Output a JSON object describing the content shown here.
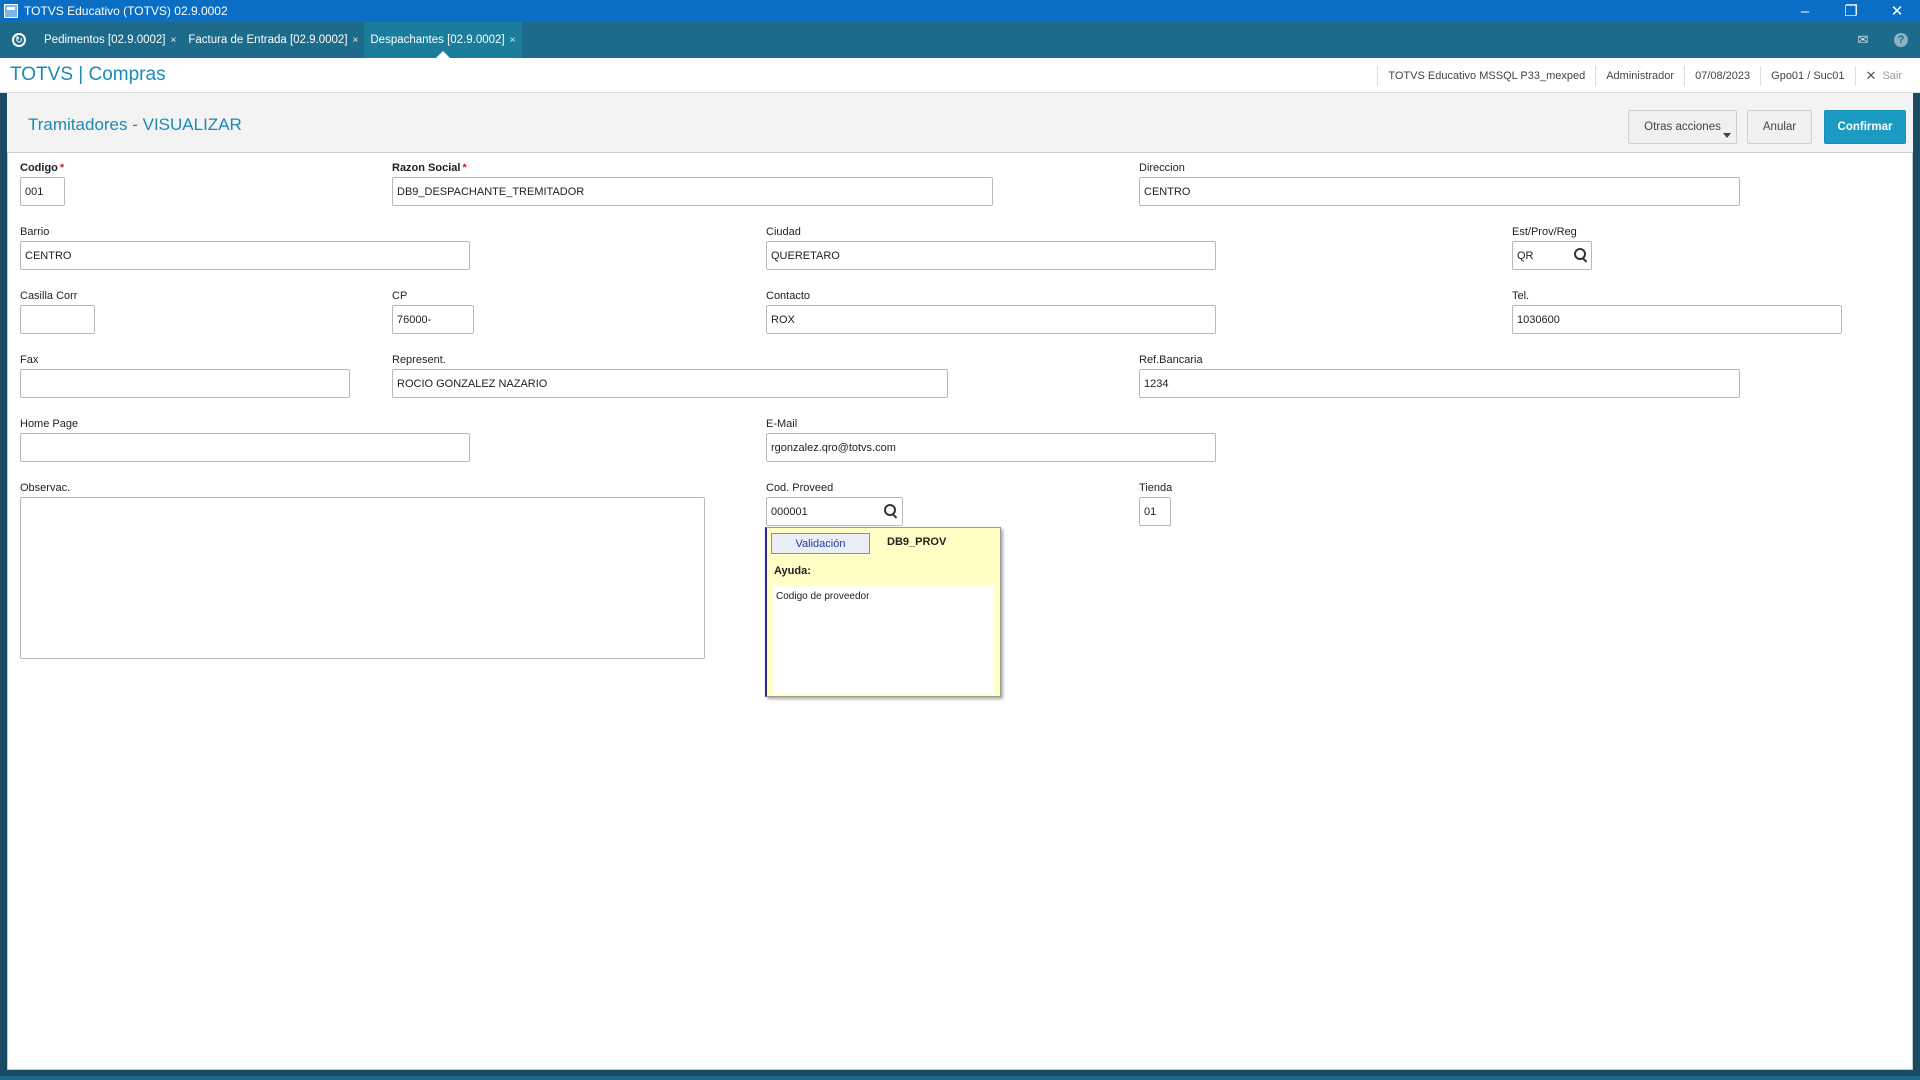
{
  "window": {
    "title": "TOTVS Educativo (TOTVS) 02.9.0002"
  },
  "tabs": [
    {
      "label": "Pedimentos [02.9.0002]",
      "close": "×"
    },
    {
      "label": "Factura de Entrada [02.9.0002]",
      "close": "×"
    },
    {
      "label": "Despachantes [02.9.0002]",
      "close": "×"
    }
  ],
  "module": {
    "title": "TOTVS | Compras",
    "environment": "TOTVS Educativo MSSQL P33_mexped",
    "user": "Administrador",
    "date": "07/08/2023",
    "branch": "Gpo01 / Suc01",
    "exit_label": "Sair"
  },
  "form": {
    "title": "Tramitadores - VISUALIZAR",
    "buttons": {
      "more": "Otras acciones",
      "cancel": "Anular",
      "confirm": "Confirmar"
    },
    "fields": {
      "codigo": {
        "label": "Codigo",
        "required_mark": "*",
        "value": "001"
      },
      "razon": {
        "label": "Razon Social",
        "required_mark": "*",
        "value": "DB9_DESPACHANTE_TREMITADOR"
      },
      "direccion": {
        "label": "Direccion",
        "value": "CENTRO"
      },
      "barrio": {
        "label": "Barrio",
        "value": "CENTRO"
      },
      "ciudad": {
        "label": "Ciudad",
        "value": "QUERETARO"
      },
      "estado": {
        "label": "Est/Prov/Reg",
        "value": "QR"
      },
      "casilla": {
        "label": "Casilla Corr",
        "value": ""
      },
      "cp": {
        "label": "CP",
        "value": "76000-"
      },
      "contacto": {
        "label": "Contacto",
        "value": "ROX"
      },
      "tel": {
        "label": "Tel.",
        "value": "1030600"
      },
      "fax": {
        "label": "Fax",
        "value": ""
      },
      "represent": {
        "label": "Represent.",
        "value": "ROCIO GONZALEZ NAZARIO"
      },
      "refbanc": {
        "label": "Ref.Bancaria",
        "value": "1234"
      },
      "homepage": {
        "label": "Home Page",
        "value": ""
      },
      "email": {
        "label": "E-Mail",
        "value": "rgonzalez.qro@totvs.com"
      },
      "observ": {
        "label": "Observac.",
        "value": ""
      },
      "codprov": {
        "label": "Cod. Proveed",
        "value": "000001"
      },
      "tienda": {
        "label": "Tienda",
        "value": "01"
      }
    }
  },
  "help_tooltip": {
    "validation_label": "Validación",
    "code": "DB9_PROV",
    "heading": "Ayuda:",
    "text": "Codigo de proveedor"
  },
  "icons": {
    "window": "app-window-icon",
    "home": "totvs-home-icon",
    "mail": "mail-icon",
    "help": "help-icon",
    "lookup": "search-icon",
    "close": "close-icon"
  },
  "colors": {
    "titlebar": "#0a6fc4",
    "tabbar": "#1d6b8a",
    "accent": "#1b8ab4",
    "confirm": "#1b9ac3",
    "tooltip": "#fffec4"
  }
}
